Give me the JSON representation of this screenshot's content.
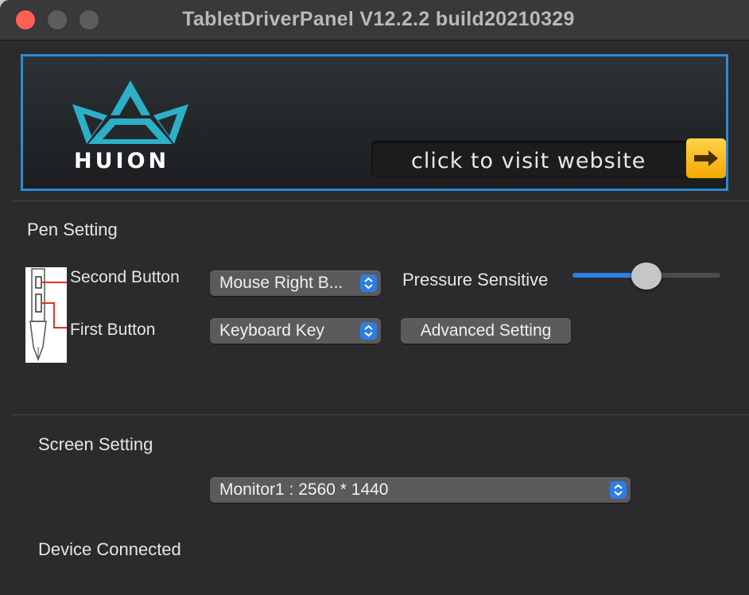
{
  "window": {
    "title": "TabletDriverPanel V12.2.2 build20210329"
  },
  "banner": {
    "logo_text": "HUION",
    "visit_label": "click to visit website",
    "logo_color": "#2bb0c8",
    "border_color": "#2d8ad4"
  },
  "pen": {
    "section_title": "Pen Setting",
    "second_button_label": "Second Button",
    "second_button_value": "Mouse Right B...",
    "first_button_label": "First Button",
    "first_button_value": "Keyboard Key",
    "pressure_label": "Pressure Sensitive",
    "pressure_value": 0.5,
    "advanced_button": "Advanced Setting"
  },
  "screen": {
    "section_title": "Screen Setting",
    "monitor_value": "Monitor1 : 2560 * 1440"
  },
  "device": {
    "status": "Device Connected"
  },
  "colors": {
    "accent": "#2f7de3",
    "close": "#fe5f57"
  }
}
